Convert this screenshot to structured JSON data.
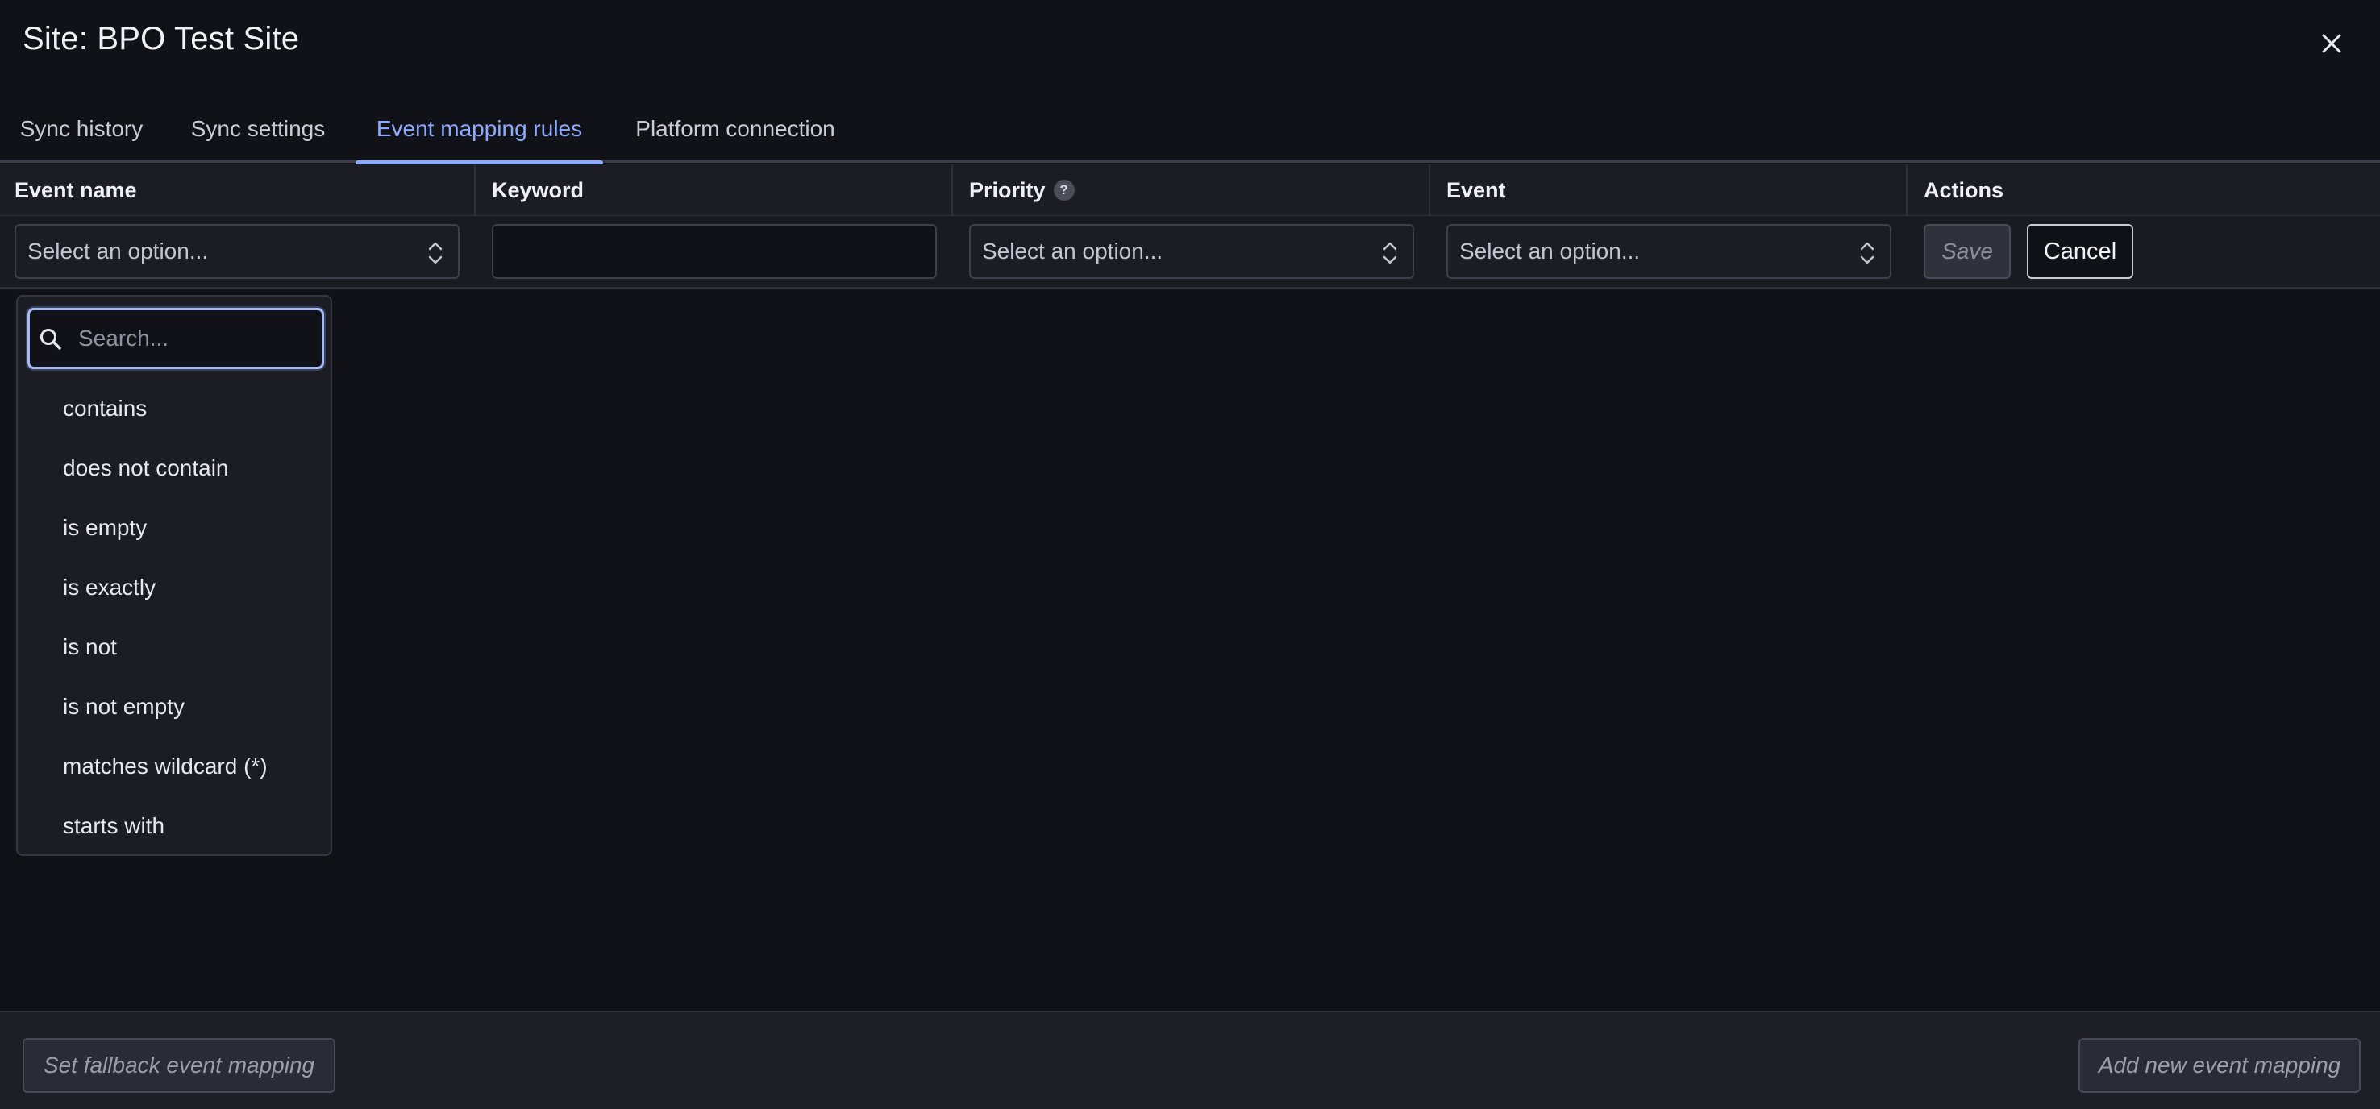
{
  "window": {
    "title": "Site: BPO Test Site",
    "close_icon": "close-icon"
  },
  "tabs": [
    {
      "label": "Sync history",
      "active": false
    },
    {
      "label": "Sync settings",
      "active": false
    },
    {
      "label": "Event mapping rules",
      "active": true
    },
    {
      "label": "Platform connection",
      "active": false
    }
  ],
  "table": {
    "columns": [
      "Event name",
      "Keyword",
      "Priority",
      "Event",
      "Actions"
    ],
    "priority_help_icon": "?"
  },
  "edit_row": {
    "event_name_placeholder": "Select an option...",
    "keyword_value": "",
    "priority_placeholder": "Select an option...",
    "event_placeholder": "Select an option...",
    "save_label": "Save",
    "cancel_label": "Cancel"
  },
  "dropdown": {
    "search_placeholder": "Search...",
    "options": [
      "contains",
      "does not contain",
      "is empty",
      "is exactly",
      "is not",
      "is not empty",
      "matches wildcard (*)",
      "starts with"
    ]
  },
  "footer": {
    "fallback_label": "Set fallback event mapping",
    "add_label": "Add new event mapping"
  },
  "colors": {
    "background": "#111217",
    "accent": "#8eaaff",
    "surface": "#1c1d24"
  }
}
